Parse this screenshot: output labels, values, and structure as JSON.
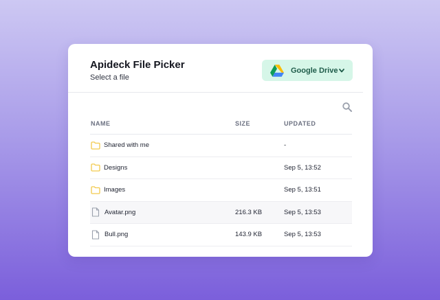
{
  "picker": {
    "title": "Apideck File Picker",
    "subtitle": "Select a file",
    "provider_label": "Google Drive"
  },
  "table": {
    "headers": {
      "name": "NAME",
      "size": "SIZE",
      "updated": "UPDATED"
    },
    "rows": [
      {
        "type": "folder",
        "name": "Shared with me",
        "size": "",
        "updated": "-"
      },
      {
        "type": "folder",
        "name": "Designs",
        "size": "",
        "updated": "Sep 5, 13:52"
      },
      {
        "type": "folder",
        "name": "Images",
        "size": "",
        "updated": "Sep 5, 13:51"
      },
      {
        "type": "file",
        "name": "Avatar.png",
        "size": "216.3 KB",
        "updated": "Sep 5, 13:53"
      },
      {
        "type": "file",
        "name": "Bull.png",
        "size": "143.9 KB",
        "updated": "Sep 5, 13:53"
      }
    ]
  },
  "colors": {
    "provider_bg": "#d6f6e8",
    "folder_icon": "#f2c94c",
    "file_icon": "#9aa0ac",
    "hover_row": "#f7f7f9"
  },
  "icons": {
    "provider": "google-drive-icon",
    "dropdown": "chevron-down-icon",
    "search": "search-icon",
    "folder": "folder-icon",
    "file": "file-icon"
  }
}
